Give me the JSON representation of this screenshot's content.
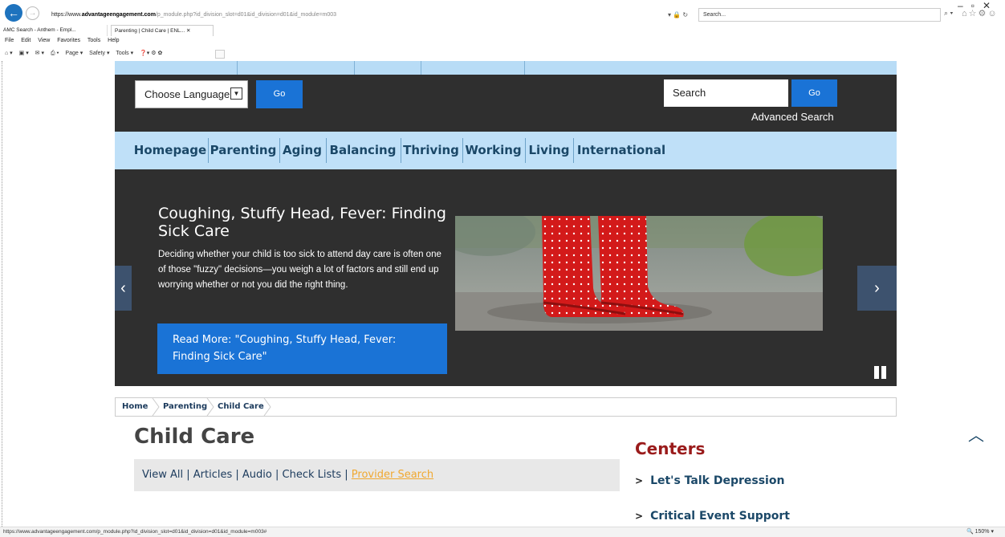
{
  "browser": {
    "url_prefix": "https://www.",
    "url_host": "advantageengagement.com",
    "url_path": "/p_module.php?id_division_slot=d01&id_division=d01&id_module=m003",
    "search_placeholder": "Search...",
    "tabs": [
      "AMC Search - Anthem - Empl...",
      "Parenting | Child Care | ENL..."
    ],
    "menu": [
      "File",
      "Edit",
      "View",
      "Favorites",
      "Tools",
      "Help"
    ],
    "commands": [
      "Page ▾",
      "Safety ▾",
      "Tools ▾"
    ],
    "status_url": "https://www.advantageengagement.com/p_module.php?id_division_slot=d01&id_division=d01&id_module=m003#",
    "zoom": "150%"
  },
  "header": {
    "language_label": "Choose Language",
    "language_go": "Go",
    "search_value": "Search",
    "search_go": "Go",
    "advanced_search": "Advanced Search"
  },
  "nav": {
    "items": [
      "Homepage",
      "Parenting",
      "Aging",
      "Balancing",
      "Thriving",
      "Working",
      "Living",
      "International"
    ]
  },
  "hero": {
    "title": "Coughing, Stuffy Head, Fever: Finding Sick Care",
    "description": "Deciding whether your child is too sick to attend day care is often one of those \"fuzzy\" decisions—you weigh a lot of factors and still end up worrying whether or not you did the right thing.",
    "read_more": "Read More: \"Coughing, Stuffy Head, Fever: Finding Sick Care\""
  },
  "breadcrumb": [
    "Home",
    "Parenting",
    "Child Care"
  ],
  "main": {
    "title": "Child Care",
    "filters": [
      "View All",
      "Articles",
      "Audio",
      "Check Lists"
    ],
    "filter_highlight": "Provider Search"
  },
  "centers": {
    "title": "Centers",
    "links": [
      "Let's Talk Depression",
      "Critical Event Support"
    ]
  },
  "colors": {
    "accent_blue": "#1a73d6",
    "nav_bg": "#bfe0f8",
    "dark_bg": "#2f2f2f",
    "centers_red": "#9a1b1b",
    "link_orange": "#f0a830"
  }
}
